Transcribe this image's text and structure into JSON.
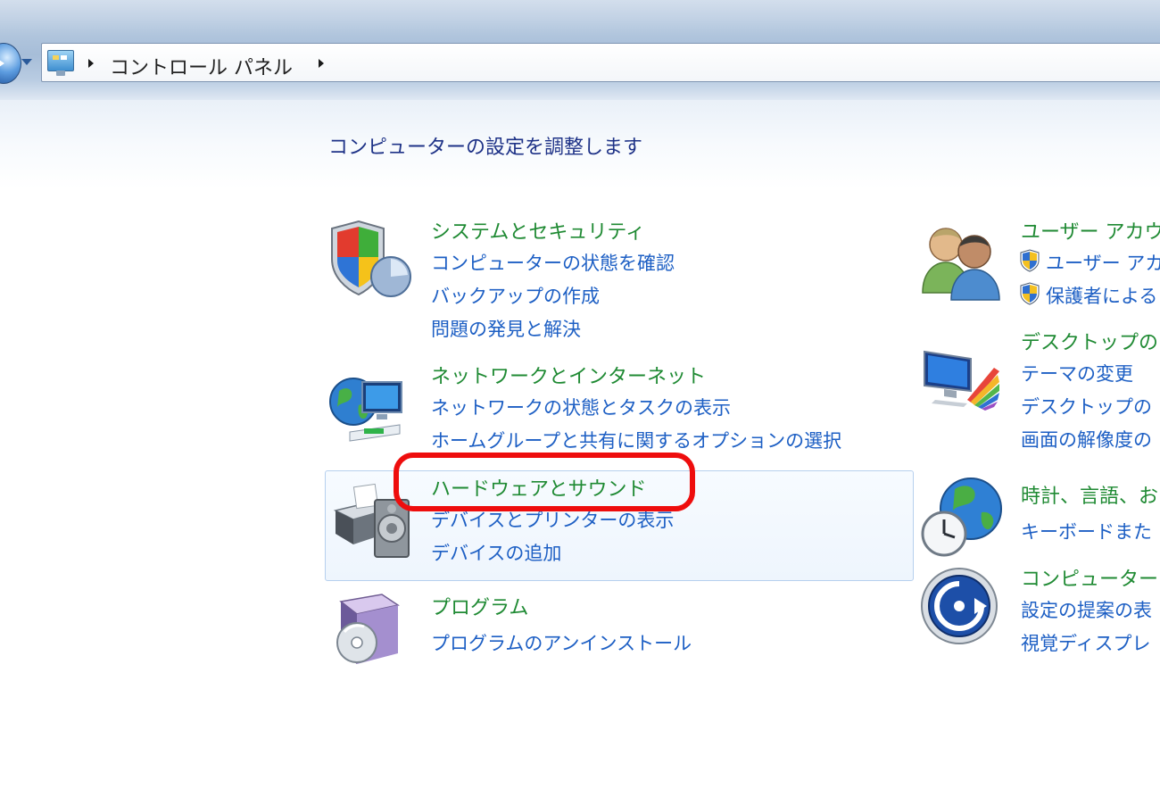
{
  "address_bar": {
    "path": "コントロール パネル"
  },
  "page_title": "コンピューターの設定を調整します",
  "left_categories": [
    {
      "icon": "security-shield-icon",
      "title": "システムとセキュリティ",
      "links": [
        "コンピューターの状態を確認",
        "バックアップの作成",
        "問題の発見と解決"
      ]
    },
    {
      "icon": "network-globe-icon",
      "title": "ネットワークとインターネット",
      "links": [
        "ネットワークの状態とタスクの表示",
        "ホームグループと共有に関するオプションの選択"
      ]
    },
    {
      "icon": "printer-speaker-icon",
      "title": "ハードウェアとサウンド",
      "links": [
        "デバイスとプリンターの表示",
        "デバイスの追加"
      ]
    },
    {
      "icon": "program-cd-icon",
      "title": "プログラム",
      "links": [
        "プログラムのアンインストール"
      ]
    }
  ],
  "right_categories": [
    {
      "icon": "users-icon",
      "title": "ユーザー アカウ",
      "links": [
        "ユーザー アカ",
        "保護者による"
      ]
    },
    {
      "icon": "desktop-display-icon",
      "title": "デスクトップの",
      "links": [
        "テーマの変更",
        "デスクトップの",
        "画面の解像度の"
      ]
    },
    {
      "icon": "clock-globe-icon",
      "title": "時計、言語、お",
      "links": [
        "キーボードまた"
      ]
    },
    {
      "icon": "ease-of-access-icon",
      "title": "コンピューター",
      "links": [
        "設定の提案の表",
        "視覚ディスプレ"
      ]
    }
  ],
  "colors": {
    "category_title": "#1f8a33",
    "link": "#1d5fc4",
    "heading": "#1e3287",
    "highlight_annotation": "#ee0d0d"
  }
}
